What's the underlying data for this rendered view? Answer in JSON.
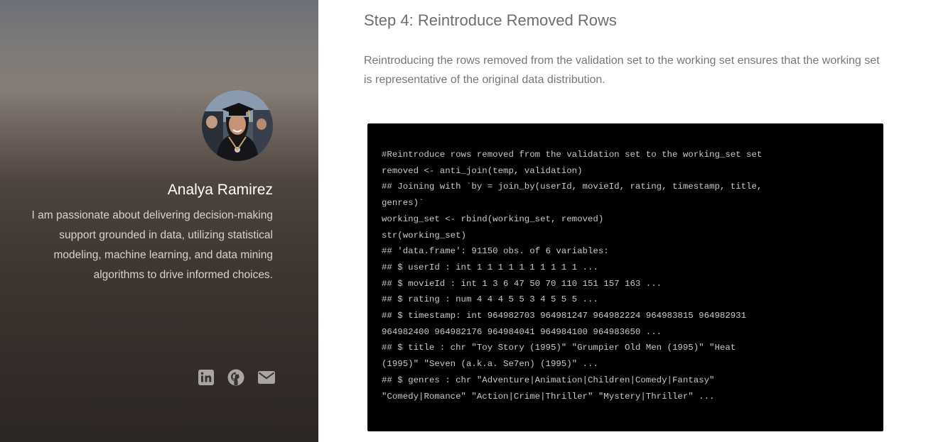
{
  "sidebar": {
    "avatar_alt": "Analya Ramirez",
    "author_name": "Analya Ramirez",
    "author_bio": "I am passionate about delivering decision-making support grounded in data, utilizing statistical modeling, machine learning, and data mining algorithms to drive informed choices.",
    "social": [
      {
        "icon": "linkedin-icon",
        "label": "LinkedIn"
      },
      {
        "icon": "github-icon",
        "label": "GitHub"
      },
      {
        "icon": "envelope-icon",
        "label": "Email"
      }
    ]
  },
  "main": {
    "step_title": "Step 4: Reintroduce Removed Rows",
    "intro": "Reintroducing the rows removed from the validation set to the working set ensures that the working set is representative of the original data distribution.",
    "code_lines": [
      "#Reintroduce rows removed from the validation set to the working_set set",
      "removed <- anti_join(temp, validation)",
      "## Joining with `by = join_by(userId, movieId, rating, timestamp, title,",
      "genres)`",
      "working_set <- rbind(working_set, removed)",
      "str(working_set)",
      "## 'data.frame': 91150 obs. of 6 variables:",
      "## $ userId : int 1 1 1 1 1 1 1 1 1 1 ...",
      "## $ movieId : int 1 3 6 47 50 70 110 151 157 163 ...",
      "## $ rating : num 4 4 4 5 5 3 4 5 5 5 ...",
      "## $ timestamp: int 964982703 964981247 964982224 964983815 964982931",
      "964982400 964982176 964984041 964984100 964983650 ...",
      "## $ title : chr \"Toy Story (1995)\" \"Grumpier Old Men (1995)\" \"Heat",
      "(1995)\" \"Seven (a.k.a. Se7en) (1995)\" ...",
      "## $ genres : chr \"Adventure|Animation|Children|Comedy|Fantasy\"",
      "\"Comedy|Romance\" \"Action|Crime|Thriller\" \"Mystery|Thriller\" ..."
    ]
  },
  "colors": {
    "code_background": "#000000",
    "code_text": "#c8c8c8",
    "title_text": "#6e6e6e",
    "body_text": "#777777",
    "sidebar_name": "#ffffff",
    "sidebar_bio": "#d9d2cc",
    "social_icons": "#a9a5a2"
  }
}
